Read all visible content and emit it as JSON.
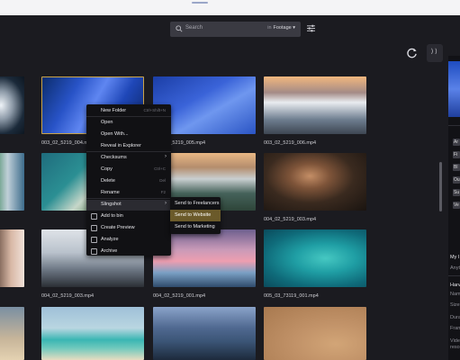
{
  "search": {
    "placeholder": "Search",
    "scope_prefix": "in",
    "scope_value": "Footage ▾"
  },
  "icons": {
    "search": "search-icon",
    "filter": "sliders-icon",
    "refresh": "refresh-icon",
    "collapse": "collapse-panel-icon"
  },
  "collapse_glyph": "⟩⟩",
  "thumbnails": [
    {
      "caption": "",
      "art": "t-ice"
    },
    {
      "caption": "003_02_5219_004.mp4",
      "art": "t-snowA",
      "selected": true
    },
    {
      "caption": "003_02_5219_005.mp4",
      "art": "t-snowB"
    },
    {
      "caption": "003_02_5219_006.mp4",
      "art": "t-mtn"
    },
    {
      "caption": "",
      "art": "t-coastL"
    },
    {
      "caption": "",
      "art": "t-coast"
    },
    {
      "caption": "",
      "art": "t-hill"
    },
    {
      "caption": "004_02_5219_003.mp4",
      "art": "t-portrait"
    },
    {
      "caption": "",
      "art": "t-skinL"
    },
    {
      "caption": "004_02_5219_003.mp4",
      "art": "t-street"
    },
    {
      "caption": "004_02_5219_001.mp4",
      "art": "t-sunset"
    },
    {
      "caption": "005_03_73119_001.mp4",
      "art": "t-reef"
    },
    {
      "caption": "",
      "art": "t-beachL"
    },
    {
      "caption": "",
      "art": "t-beach"
    },
    {
      "caption": "",
      "art": "t-storm"
    },
    {
      "caption": "",
      "art": "t-sand"
    }
  ],
  "context_menu": {
    "items": [
      {
        "label": "New Folder",
        "shortcut": "Ctrl+Shift+N"
      },
      {
        "label": "Open",
        "shortcut": ""
      },
      {
        "label": "Open With...",
        "shortcut": ""
      },
      {
        "label": "Reveal in Explorer",
        "shortcut": ""
      },
      {
        "label": "Checksums",
        "shortcut": "",
        "submenu": true
      },
      {
        "label": "Copy",
        "shortcut": "Ctrl+C"
      },
      {
        "label": "Delete",
        "shortcut": "Del"
      },
      {
        "label": "Rename",
        "shortcut": "F2"
      },
      {
        "label": "Slingshot",
        "shortcut": "",
        "submenu": true,
        "active": true
      },
      {
        "label": "Add to bin",
        "shortcut": "",
        "icon": "bin-icon"
      },
      {
        "label": "Create Preview",
        "shortcut": "",
        "icon": "preview-icon"
      },
      {
        "label": "Analyze",
        "shortcut": "",
        "icon": "analyze-icon"
      },
      {
        "label": "Archive",
        "shortcut": "",
        "icon": "archive-icon"
      }
    ]
  },
  "submenu": {
    "items": [
      {
        "label": "Send to Freelancers"
      },
      {
        "label": "Send to Website",
        "active": true
      },
      {
        "label": "Send to Marketing"
      }
    ]
  },
  "right_panel": {
    "chips": [
      "Ar",
      "Fi",
      "Bl",
      "Ou",
      "Su",
      "Ve"
    ],
    "texts": [
      "My I",
      "Anyt",
      "Harv",
      "Nam",
      "Size",
      "Dura",
      "Fram",
      "Vide",
      "resol"
    ]
  }
}
